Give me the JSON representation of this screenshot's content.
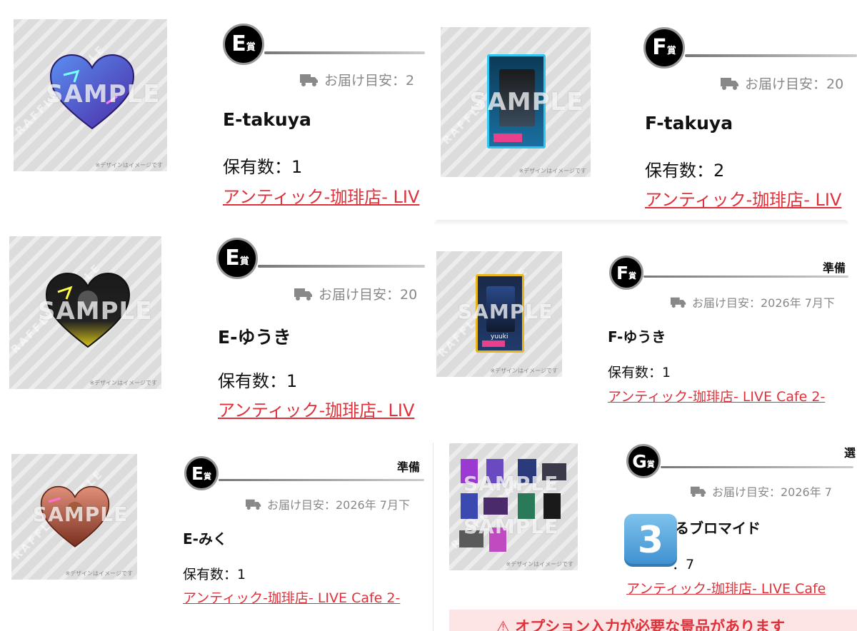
{
  "common": {
    "design_note": "※デザインはイメージです",
    "sample": "SAMPLE",
    "raffle": "RAFFLE RAFFLE"
  },
  "tiles": [
    {
      "badge_letter": "E",
      "badge_suffix": "賞",
      "delivery": "お届け目安：2",
      "title": "E-takuya",
      "count": "保有数：1",
      "link": "アンティック-珈琲店- LIV"
    },
    {
      "badge_letter": "F",
      "badge_suffix": "賞",
      "delivery": "お届け目安：20",
      "title": "F-takuya",
      "count": "保有数：2",
      "link": "アンティック-珈琲店- LIV"
    },
    {
      "badge_letter": "E",
      "badge_suffix": "賞",
      "delivery": "お届け目安：20",
      "title": "E-ゆうき",
      "count": "保有数：1",
      "link": "アンティック-珈琲店- LIV"
    },
    {
      "badge_letter": "F",
      "badge_suffix": "賞",
      "status": "準備",
      "delivery": "お届け目安：2026年 7月下",
      "title": "F-ゆうき",
      "count": "保有数：1",
      "link": "アンティック-珈琲店- LIVE Cafe 2-",
      "card_name": "yuuki"
    },
    {
      "badge_letter": "E",
      "badge_suffix": "賞",
      "status": "準備",
      "delivery": "お届け目安：2026年 7月下",
      "title": "E-みく",
      "count": "保有数：1",
      "link": "アンティック-珈琲店- LIVE Cafe 2-"
    },
    {
      "badge_letter": "G",
      "badge_suffix": "賞",
      "status": "選",
      "delivery": "お届け目安：2026年 7",
      "title": "るブロマイド",
      "count": "：7",
      "link": "アンティック-珈琲店- LIVE Cafe",
      "overlay_emoji": "3",
      "alert": "⚠ オプション入力が必要な景品があります"
    }
  ],
  "colors": {
    "link": "#e0313a",
    "badge_bg": "#000000",
    "badge_ring": "#999999",
    "muted": "#888888",
    "alert_bg": "#fde5e5"
  }
}
